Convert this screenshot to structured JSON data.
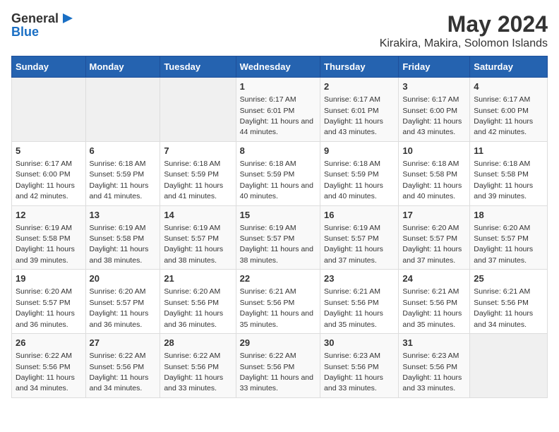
{
  "header": {
    "logo_general": "General",
    "logo_blue": "Blue",
    "title": "May 2024",
    "subtitle": "Kirakira, Makira, Solomon Islands"
  },
  "weekdays": [
    "Sunday",
    "Monday",
    "Tuesday",
    "Wednesday",
    "Thursday",
    "Friday",
    "Saturday"
  ],
  "weeks": [
    [
      {
        "day": "",
        "sunrise": "",
        "sunset": "",
        "daylight": ""
      },
      {
        "day": "",
        "sunrise": "",
        "sunset": "",
        "daylight": ""
      },
      {
        "day": "",
        "sunrise": "",
        "sunset": "",
        "daylight": ""
      },
      {
        "day": "1",
        "sunrise": "Sunrise: 6:17 AM",
        "sunset": "Sunset: 6:01 PM",
        "daylight": "Daylight: 11 hours and 44 minutes."
      },
      {
        "day": "2",
        "sunrise": "Sunrise: 6:17 AM",
        "sunset": "Sunset: 6:01 PM",
        "daylight": "Daylight: 11 hours and 43 minutes."
      },
      {
        "day": "3",
        "sunrise": "Sunrise: 6:17 AM",
        "sunset": "Sunset: 6:00 PM",
        "daylight": "Daylight: 11 hours and 43 minutes."
      },
      {
        "day": "4",
        "sunrise": "Sunrise: 6:17 AM",
        "sunset": "Sunset: 6:00 PM",
        "daylight": "Daylight: 11 hours and 42 minutes."
      }
    ],
    [
      {
        "day": "5",
        "sunrise": "Sunrise: 6:17 AM",
        "sunset": "Sunset: 6:00 PM",
        "daylight": "Daylight: 11 hours and 42 minutes."
      },
      {
        "day": "6",
        "sunrise": "Sunrise: 6:18 AM",
        "sunset": "Sunset: 5:59 PM",
        "daylight": "Daylight: 11 hours and 41 minutes."
      },
      {
        "day": "7",
        "sunrise": "Sunrise: 6:18 AM",
        "sunset": "Sunset: 5:59 PM",
        "daylight": "Daylight: 11 hours and 41 minutes."
      },
      {
        "day": "8",
        "sunrise": "Sunrise: 6:18 AM",
        "sunset": "Sunset: 5:59 PM",
        "daylight": "Daylight: 11 hours and 40 minutes."
      },
      {
        "day": "9",
        "sunrise": "Sunrise: 6:18 AM",
        "sunset": "Sunset: 5:59 PM",
        "daylight": "Daylight: 11 hours and 40 minutes."
      },
      {
        "day": "10",
        "sunrise": "Sunrise: 6:18 AM",
        "sunset": "Sunset: 5:58 PM",
        "daylight": "Daylight: 11 hours and 40 minutes."
      },
      {
        "day": "11",
        "sunrise": "Sunrise: 6:18 AM",
        "sunset": "Sunset: 5:58 PM",
        "daylight": "Daylight: 11 hours and 39 minutes."
      }
    ],
    [
      {
        "day": "12",
        "sunrise": "Sunrise: 6:19 AM",
        "sunset": "Sunset: 5:58 PM",
        "daylight": "Daylight: 11 hours and 39 minutes."
      },
      {
        "day": "13",
        "sunrise": "Sunrise: 6:19 AM",
        "sunset": "Sunset: 5:58 PM",
        "daylight": "Daylight: 11 hours and 38 minutes."
      },
      {
        "day": "14",
        "sunrise": "Sunrise: 6:19 AM",
        "sunset": "Sunset: 5:57 PM",
        "daylight": "Daylight: 11 hours and 38 minutes."
      },
      {
        "day": "15",
        "sunrise": "Sunrise: 6:19 AM",
        "sunset": "Sunset: 5:57 PM",
        "daylight": "Daylight: 11 hours and 38 minutes."
      },
      {
        "day": "16",
        "sunrise": "Sunrise: 6:19 AM",
        "sunset": "Sunset: 5:57 PM",
        "daylight": "Daylight: 11 hours and 37 minutes."
      },
      {
        "day": "17",
        "sunrise": "Sunrise: 6:20 AM",
        "sunset": "Sunset: 5:57 PM",
        "daylight": "Daylight: 11 hours and 37 minutes."
      },
      {
        "day": "18",
        "sunrise": "Sunrise: 6:20 AM",
        "sunset": "Sunset: 5:57 PM",
        "daylight": "Daylight: 11 hours and 37 minutes."
      }
    ],
    [
      {
        "day": "19",
        "sunrise": "Sunrise: 6:20 AM",
        "sunset": "Sunset: 5:57 PM",
        "daylight": "Daylight: 11 hours and 36 minutes."
      },
      {
        "day": "20",
        "sunrise": "Sunrise: 6:20 AM",
        "sunset": "Sunset: 5:57 PM",
        "daylight": "Daylight: 11 hours and 36 minutes."
      },
      {
        "day": "21",
        "sunrise": "Sunrise: 6:20 AM",
        "sunset": "Sunset: 5:56 PM",
        "daylight": "Daylight: 11 hours and 36 minutes."
      },
      {
        "day": "22",
        "sunrise": "Sunrise: 6:21 AM",
        "sunset": "Sunset: 5:56 PM",
        "daylight": "Daylight: 11 hours and 35 minutes."
      },
      {
        "day": "23",
        "sunrise": "Sunrise: 6:21 AM",
        "sunset": "Sunset: 5:56 PM",
        "daylight": "Daylight: 11 hours and 35 minutes."
      },
      {
        "day": "24",
        "sunrise": "Sunrise: 6:21 AM",
        "sunset": "Sunset: 5:56 PM",
        "daylight": "Daylight: 11 hours and 35 minutes."
      },
      {
        "day": "25",
        "sunrise": "Sunrise: 6:21 AM",
        "sunset": "Sunset: 5:56 PM",
        "daylight": "Daylight: 11 hours and 34 minutes."
      }
    ],
    [
      {
        "day": "26",
        "sunrise": "Sunrise: 6:22 AM",
        "sunset": "Sunset: 5:56 PM",
        "daylight": "Daylight: 11 hours and 34 minutes."
      },
      {
        "day": "27",
        "sunrise": "Sunrise: 6:22 AM",
        "sunset": "Sunset: 5:56 PM",
        "daylight": "Daylight: 11 hours and 34 minutes."
      },
      {
        "day": "28",
        "sunrise": "Sunrise: 6:22 AM",
        "sunset": "Sunset: 5:56 PM",
        "daylight": "Daylight: 11 hours and 33 minutes."
      },
      {
        "day": "29",
        "sunrise": "Sunrise: 6:22 AM",
        "sunset": "Sunset: 5:56 PM",
        "daylight": "Daylight: 11 hours and 33 minutes."
      },
      {
        "day": "30",
        "sunrise": "Sunrise: 6:23 AM",
        "sunset": "Sunset: 5:56 PM",
        "daylight": "Daylight: 11 hours and 33 minutes."
      },
      {
        "day": "31",
        "sunrise": "Sunrise: 6:23 AM",
        "sunset": "Sunset: 5:56 PM",
        "daylight": "Daylight: 11 hours and 33 minutes."
      },
      {
        "day": "",
        "sunrise": "",
        "sunset": "",
        "daylight": ""
      }
    ]
  ]
}
